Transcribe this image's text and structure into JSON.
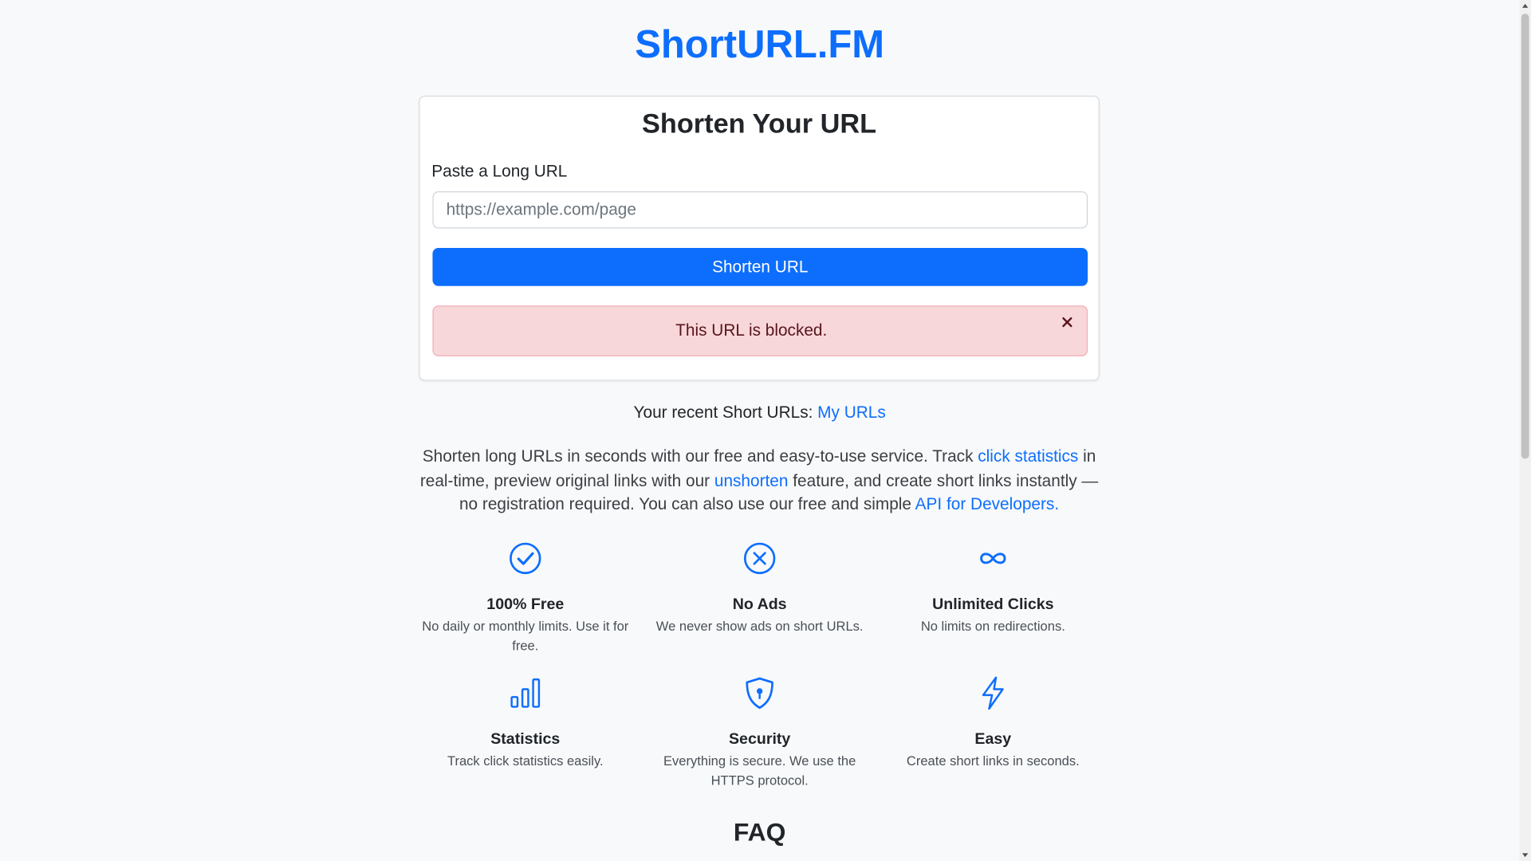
{
  "site": {
    "title": "ShortURL.FM"
  },
  "form": {
    "heading": "Shorten Your URL",
    "label": "Paste a Long URL",
    "placeholder": "https://example.com/page",
    "value": "",
    "button_label": "Shorten URL"
  },
  "alert": {
    "message": "This URL is blocked.",
    "close_icon": "close-icon"
  },
  "recent": {
    "prefix": "Your recent Short URLs: ",
    "link_text": "My URLs"
  },
  "intro": {
    "part1": "Shorten long URLs in seconds with our free and easy-to-use service. Track ",
    "link1": "click statistics",
    "part2": " in real-time, preview original links with our ",
    "link2": "unshorten",
    "part3": " feature, and create short links instantly — no registration required. You can also use our free and simple ",
    "link3": "API for Developers."
  },
  "features": [
    {
      "icon": "check-circle-icon",
      "title": "100% Free",
      "desc": "No daily or monthly limits. Use it for free."
    },
    {
      "icon": "x-circle-icon",
      "title": "No Ads",
      "desc": "We never show ads on short URLs."
    },
    {
      "icon": "infinity-icon",
      "title": "Unlimited Clicks",
      "desc": "No limits on redirections."
    },
    {
      "icon": "bar-chart-icon",
      "title": "Statistics",
      "desc": "Track click statistics easily."
    },
    {
      "icon": "shield-lock-icon",
      "title": "Security",
      "desc": "Everything is secure. We use the HTTPS protocol."
    },
    {
      "icon": "lightning-icon",
      "title": "Easy",
      "desc": "Create short links in seconds."
    }
  ],
  "faq": {
    "heading": "FAQ"
  },
  "colors": {
    "primary": "#0d6efd",
    "alert_bg": "#f8d7da",
    "alert_text": "#58151c",
    "page_bg": "#f8f9fa"
  }
}
